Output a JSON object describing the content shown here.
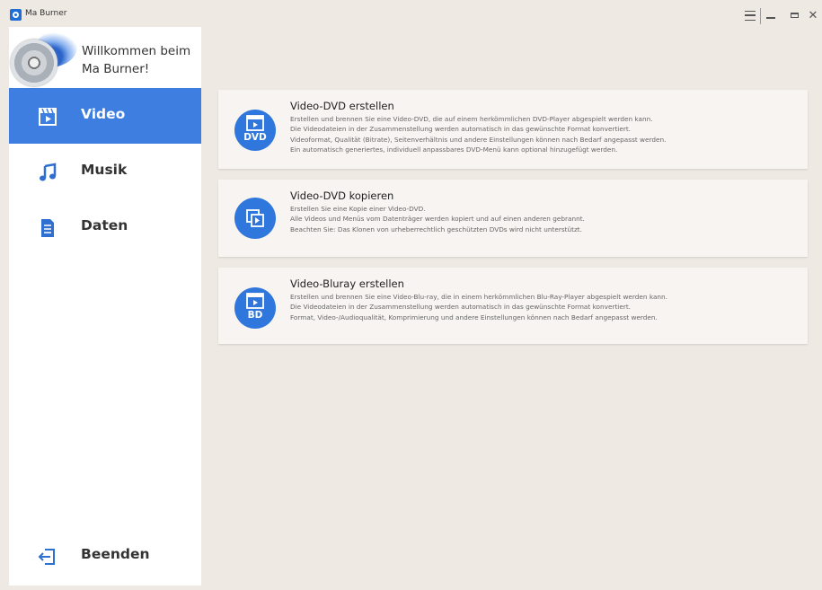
{
  "window": {
    "title": "Ma Burner",
    "icons": [
      "app-icon",
      "menu-icon",
      "minimize-icon",
      "maximize-icon",
      "close-icon"
    ]
  },
  "sidebar": {
    "welcome": "Willkommen beim Ma Burner!",
    "items": [
      {
        "label": "Video",
        "icon": "video-clapper-icon",
        "active": true
      },
      {
        "label": "Musik",
        "icon": "music-note-icon",
        "active": false
      },
      {
        "label": "Daten",
        "icon": "document-icon",
        "active": false
      }
    ],
    "exit_label": "Beenden",
    "exit_icon": "exit-icon"
  },
  "cards": [
    {
      "title": "Video-DVD erstellen",
      "icon_text": "DVD",
      "icon": "video-dvd-icon",
      "lines": [
        "Erstellen und brennen Sie eine Video-DVD, die auf einem herkömmlichen DVD-Player abgespielt werden kann.",
        "Die Videodateien in der Zusammenstellung  werden automatisch in das gewünschte Format konvertiert.",
        "Videoformat, Qualität (Bitrate), Seitenverhältnis und andere Einstellungen können nach Bedarf angepasst werden.",
        "Ein automatisch generiertes, individuell anpassbares DVD-Menü kann optional hinzugefügt werden."
      ]
    },
    {
      "title": "Video-DVD kopieren",
      "icon_text": "",
      "icon": "copy-disc-icon",
      "lines": [
        "Erstellen Sie eine Kopie einer Video-DVD.",
        "Alle Videos und Menüs vom Datenträger werden kopiert und auf einen anderen gebrannt.",
        "Beachten Sie: Das Klonen von urheberrechtlich geschützten DVDs wird nicht unterstützt."
      ]
    },
    {
      "title": "Video-Bluray erstellen",
      "icon_text": "BD",
      "icon": "video-bluray-icon",
      "lines": [
        "Erstellen und brennen Sie eine Video-Blu-ray, die in einem herkömmlichen Blu-Ray-Player abgespielt werden kann.",
        "Die Videodateien in der Zusammenstellung werden automatisch in das gewünschte Format konvertiert.",
        "Format, Video-/Audioqualität, Komprimierung und andere Einstellungen können nach Bedarf angepasst werden."
      ]
    }
  ],
  "colors": {
    "accent": "#3d7ee0",
    "background": "#efe9e4",
    "card": "#f7f4f1"
  }
}
